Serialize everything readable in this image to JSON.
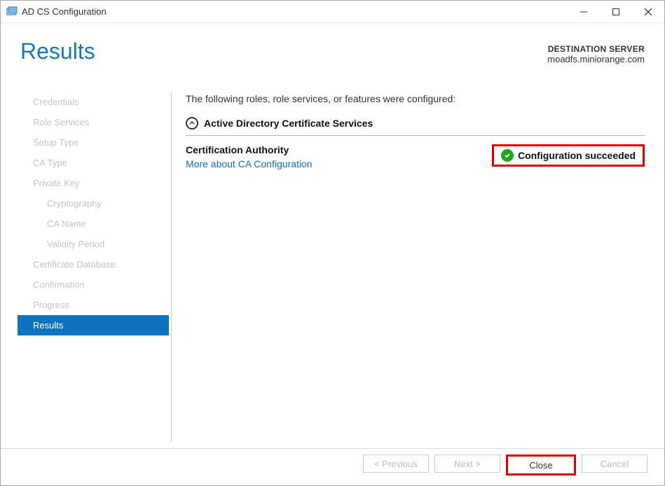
{
  "window": {
    "title": "AD CS Configuration"
  },
  "header": {
    "page_title": "Results",
    "dest_label": "DESTINATION SERVER",
    "dest_server": "moadfs.miniorange.com"
  },
  "sidebar": {
    "items": [
      {
        "label": "Credentials",
        "indented": false,
        "active": false
      },
      {
        "label": "Role Services",
        "indented": false,
        "active": false
      },
      {
        "label": "Setup Type",
        "indented": false,
        "active": false
      },
      {
        "label": "CA Type",
        "indented": false,
        "active": false
      },
      {
        "label": "Private Key",
        "indented": false,
        "active": false
      },
      {
        "label": "Cryptography",
        "indented": true,
        "active": false
      },
      {
        "label": "CA Name",
        "indented": true,
        "active": false
      },
      {
        "label": "Validity Period",
        "indented": true,
        "active": false
      },
      {
        "label": "Certificate Database",
        "indented": false,
        "active": false
      },
      {
        "label": "Confirmation",
        "indented": false,
        "active": false
      },
      {
        "label": "Progress",
        "indented": false,
        "active": false
      },
      {
        "label": "Results",
        "indented": false,
        "active": true
      }
    ]
  },
  "main": {
    "intro": "The following roles, role services, or features were configured:",
    "role_name": "Active Directory Certificate Services",
    "service_name": "Certification Authority",
    "more_link": "More about CA Configuration",
    "status_text": "Configuration succeeded"
  },
  "buttons": {
    "previous": "< Previous",
    "next": "Next >",
    "close": "Close",
    "cancel": "Cancel"
  }
}
